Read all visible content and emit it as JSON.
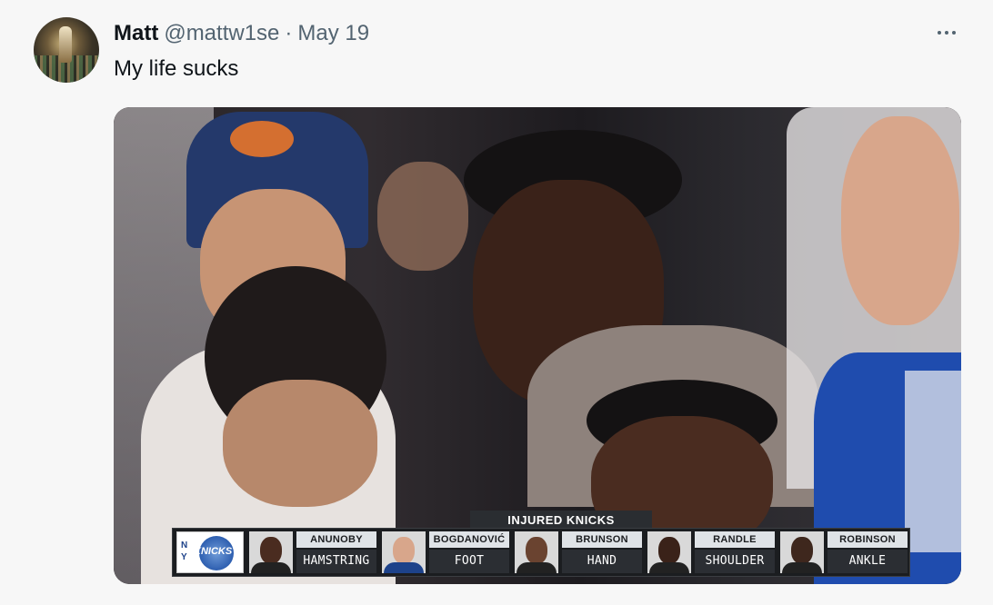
{
  "tweet": {
    "author_name": "Matt",
    "author_handle": "@mattw1se",
    "separator": "·",
    "date": "May 19",
    "text": "My life sucks",
    "more_icon": "more-dots-icon"
  },
  "media": {
    "graphic": {
      "title": "INJURED KNICKS",
      "team_abbr": "N\nY",
      "team_logo_text": "KNICKS",
      "players": [
        {
          "name": "ANUNOBY",
          "injury": "HAMSTRING"
        },
        {
          "name": "BOGDANOVIĆ",
          "injury": "FOOT"
        },
        {
          "name": "BRUNSON",
          "injury": "HAND"
        },
        {
          "name": "RANDLE",
          "injury": "SHOULDER"
        },
        {
          "name": "ROBINSON",
          "injury": "ANKLE"
        }
      ]
    }
  },
  "colors": {
    "text_primary": "#0f1419",
    "text_secondary": "#536471",
    "knicks_blue": "#1d428a",
    "knicks_orange": "#f58426"
  }
}
